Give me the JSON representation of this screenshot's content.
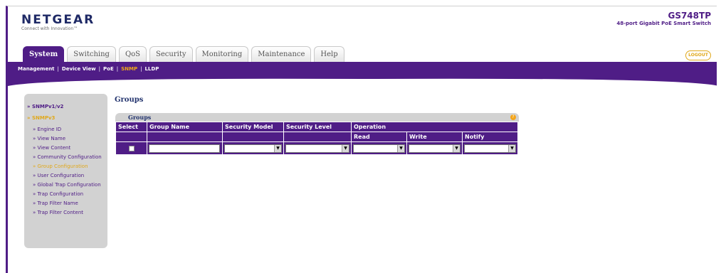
{
  "header": {
    "brand": "NETGEAR",
    "tagline": "Connect with Innovation™",
    "model": "GS748TP",
    "model_desc": "48-port Gigabit PoE Smart Switch"
  },
  "tabs": [
    "System",
    "Switching",
    "QoS",
    "Security",
    "Monitoring",
    "Maintenance",
    "Help"
  ],
  "logout_label": "LOGOUT",
  "subnav": [
    "Management",
    "Device View",
    "PoE",
    "SNMP",
    "LLDP"
  ],
  "sidebar": {
    "items": [
      {
        "label": "SNMPv1/v2",
        "level": 1
      },
      {
        "label": "SNMPv3",
        "level": 1
      },
      {
        "label": "Engine ID",
        "level": 2
      },
      {
        "label": "View Name",
        "level": 2
      },
      {
        "label": "View Content",
        "level": 2
      },
      {
        "label": "Community Configuration",
        "level": 2
      },
      {
        "label": "Group Configuration",
        "level": 2
      },
      {
        "label": "User Configuration",
        "level": 2
      },
      {
        "label": "Global Trap Configuration",
        "level": 2
      },
      {
        "label": "Trap Configuration",
        "level": 2
      },
      {
        "label": "Trap Filter Name",
        "level": 2
      },
      {
        "label": "Trap Filter Content",
        "level": 2
      }
    ]
  },
  "page_title": "Groups",
  "panel": {
    "title": "Groups",
    "help_icon": "?"
  },
  "table": {
    "headers": {
      "select": "Select",
      "group_name": "Group Name",
      "security_model": "Security Model",
      "security_level": "Security Level",
      "operation": "Operation",
      "read": "Read",
      "write": "Write",
      "notify": "Notify"
    }
  },
  "colors": {
    "accent": "#4f1d86",
    "highlight": "#e0a81b",
    "sidebar_bg": "#d2d2d2"
  }
}
